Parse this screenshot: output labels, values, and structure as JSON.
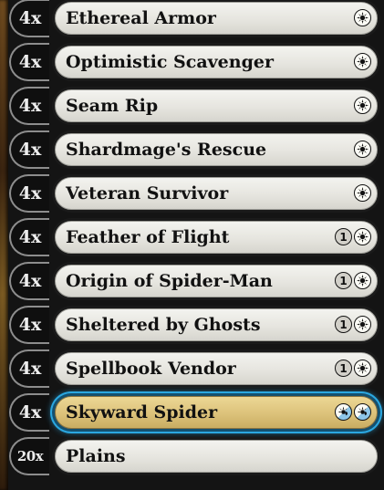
{
  "deck": {
    "rows": [
      {
        "count": "4x",
        "name": "Ethereal Armor",
        "cost": [
          "W"
        ]
      },
      {
        "count": "4x",
        "name": "Optimistic Scavenger",
        "cost": [
          "W"
        ]
      },
      {
        "count": "4x",
        "name": "Seam Rip",
        "cost": [
          "W"
        ]
      },
      {
        "count": "4x",
        "name": "Shardmage's Rescue",
        "cost": [
          "W"
        ]
      },
      {
        "count": "4x",
        "name": "Veteran Survivor",
        "cost": [
          "W"
        ]
      },
      {
        "count": "4x",
        "name": "Feather of Flight",
        "cost": [
          "1",
          "W"
        ]
      },
      {
        "count": "4x",
        "name": "Origin of Spider-Man",
        "cost": [
          "1",
          "W"
        ]
      },
      {
        "count": "4x",
        "name": "Sheltered by Ghosts",
        "cost": [
          "1",
          "W"
        ]
      },
      {
        "count": "4x",
        "name": "Spellbook Vendor",
        "cost": [
          "1",
          "W"
        ]
      },
      {
        "count": "4x",
        "name": "Skyward Spider",
        "cost": [
          "W/U",
          "W/U"
        ],
        "selected": true
      },
      {
        "count": "20x",
        "name": "Plains",
        "cost": []
      }
    ]
  },
  "colors": {
    "card_face": "#e6e5df",
    "selected_face": "#dcc27a",
    "selected_glow": "#2ba7e0",
    "white_mana": "#fbfbf5",
    "blue_mana": "#8ec6e8"
  },
  "icons": {
    "white_mana": "sun-icon",
    "generic_mana": "numeral-icon",
    "hybrid_mana": "white-blue-hybrid-icon"
  }
}
